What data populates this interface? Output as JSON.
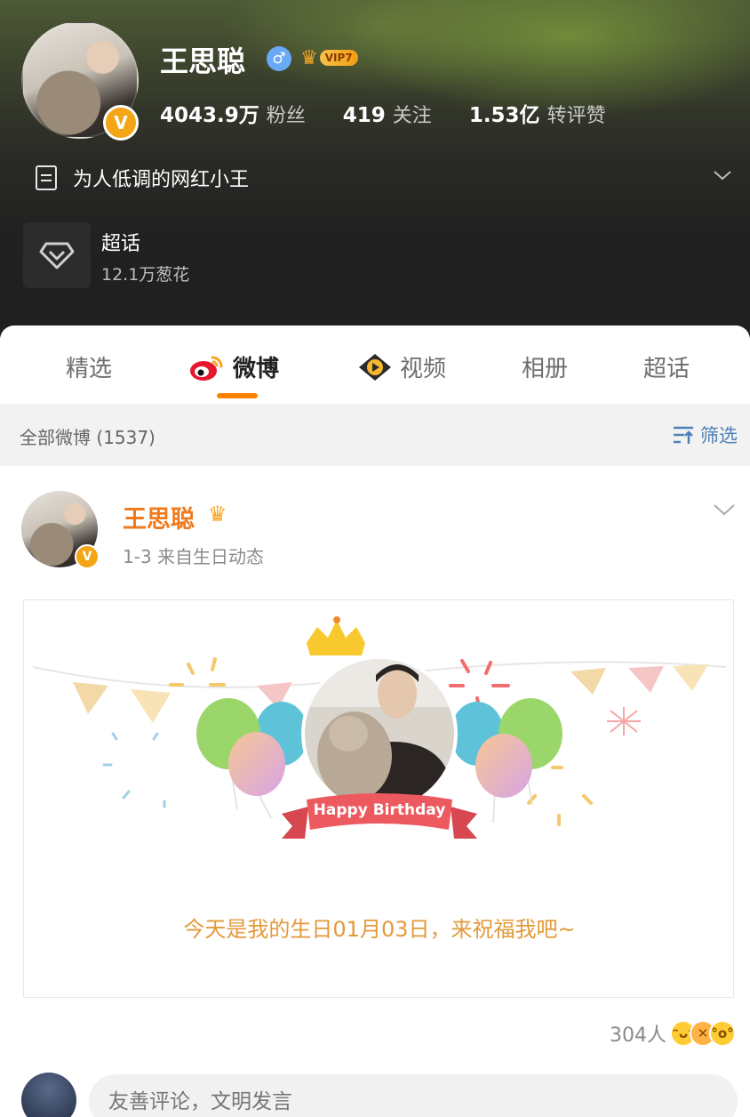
{
  "profile": {
    "name": "王思聪",
    "gender_symbol": "♂",
    "vip_label": "VIP7",
    "stats": [
      {
        "num": "4043.9万",
        "label": "粉丝"
      },
      {
        "num": "419",
        "label": "关注"
      },
      {
        "num": "1.53亿",
        "label": "转评赞"
      }
    ],
    "bio": "为人低调的网红小王",
    "supertopic": {
      "title": "超话",
      "sub": "12.1万葱花"
    },
    "verified_mark": "V"
  },
  "tabs": [
    {
      "label": "精选",
      "icon": ""
    },
    {
      "label": "微博",
      "icon": "weibo-logo-icon"
    },
    {
      "label": "视频",
      "icon": "video-play-icon"
    },
    {
      "label": "相册",
      "icon": ""
    },
    {
      "label": "超话",
      "icon": ""
    }
  ],
  "active_tab": "微博",
  "filter": {
    "count_label": "全部微博 (1537)",
    "filter_label": "筛选"
  },
  "post": {
    "author": "王思聪",
    "meta": "1-3  来自生日动态",
    "card": {
      "banner": "Happy Birthday",
      "caption": "今天是我的生日01月03日，来祝福我吧~"
    },
    "reactions": "304人"
  },
  "comment": {
    "placeholder": "友善评论，文明发言"
  },
  "colors": {
    "accent": "#ff8200",
    "name_orange": "#f07b1f",
    "link_blue": "#4f7fb8",
    "caption": "#e39a3b"
  }
}
